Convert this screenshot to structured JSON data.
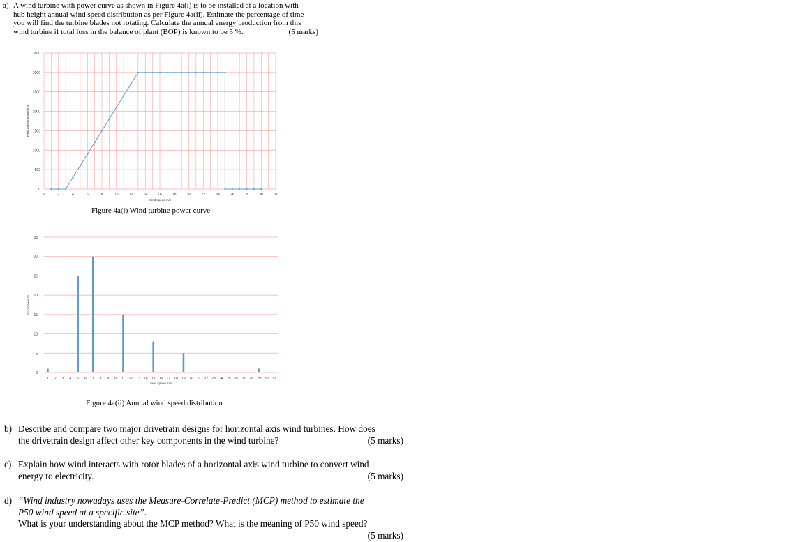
{
  "question_a": {
    "prefix": "a)",
    "lines": [
      "A wind turbine with power curve as shown in Figure 4a(i) is to be installed at a location with",
      "hub height annual wind speed distribution as per Figure 4a(ii). Estimate the percentage of time",
      "you will find the turbine blades not rotating. Calculate the annual energy production from this",
      "wind turbine if total loss in the balance of plant (BOP) is known to be 5 %."
    ],
    "marks": "(5 marks)"
  },
  "figure_a1": {
    "caption": "Figure 4a(i) Wind turbine power curve",
    "chart_data": {
      "type": "line",
      "xlabel": "Wind speed m/s",
      "ylabel": "Wind turbine power kW",
      "xlim": [
        0,
        32
      ],
      "ylim": [
        0,
        3500
      ],
      "x_ticks": [
        "0",
        "2",
        "4",
        "6",
        "8",
        "10",
        "12",
        "14",
        "16",
        "18",
        "20",
        "22",
        "24",
        "26",
        "28",
        "30",
        "32"
      ],
      "y_ticks": [
        "0",
        "500",
        "1000",
        "1500",
        "2000",
        "2500",
        "3000",
        "3500"
      ],
      "series": [
        {
          "color": "#5b9bd5",
          "points": [
            [
              1,
              0
            ],
            [
              2,
              0
            ],
            [
              3,
              0
            ],
            [
              4,
              300
            ],
            [
              5,
              600
            ],
            [
              6,
              900
            ],
            [
              7,
              1200
            ],
            [
              8,
              1500
            ],
            [
              9,
              1800
            ],
            [
              10,
              2100
            ],
            [
              11,
              2400
            ],
            [
              12,
              2700
            ],
            [
              13,
              3000
            ],
            [
              14,
              3000
            ],
            [
              15,
              3000
            ],
            [
              16,
              3000
            ],
            [
              17,
              3000
            ],
            [
              18,
              3000
            ],
            [
              19,
              3000
            ],
            [
              20,
              3000
            ],
            [
              21,
              3000
            ],
            [
              22,
              3000
            ],
            [
              23,
              3000
            ],
            [
              24,
              3000
            ],
            [
              25,
              3000
            ],
            [
              25,
              0
            ],
            [
              26,
              0
            ],
            [
              27,
              0
            ],
            [
              28,
              0
            ],
            [
              29,
              0
            ],
            [
              30,
              0
            ]
          ]
        }
      ],
      "grid": true,
      "grid_color": "#f4a6a6"
    }
  },
  "figure_a2": {
    "caption": "Figure 4a(ii) Annual wind speed distribution",
    "chart_data": {
      "type": "bar",
      "xlabel": "wind speed m/s",
      "ylabel": "Occurrence %",
      "ylim": [
        0,
        35
      ],
      "y_ticks": [
        "0",
        "5",
        "10",
        "15",
        "20",
        "25",
        "30",
        "35"
      ],
      "categories": [
        "1",
        "2",
        "3",
        "4",
        "5",
        "6",
        "7",
        "8",
        "9",
        "10",
        "11",
        "12",
        "13",
        "14",
        "15",
        "16",
        "17",
        "18",
        "19",
        "20",
        "21",
        "22",
        "23",
        "24",
        "25",
        "26",
        "27",
        "28",
        "29",
        "30",
        "31"
      ],
      "values": [
        1,
        0,
        0,
        0,
        25,
        0,
        30,
        0,
        0,
        0,
        15,
        0,
        0,
        0,
        8,
        0,
        0,
        0,
        5,
        0,
        0,
        0,
        0,
        0,
        0,
        0,
        0,
        0,
        1,
        0,
        0
      ],
      "color": "#5b9bd5",
      "grid": true,
      "grid_color": "#f4a6a6"
    }
  },
  "question_b": {
    "prefix": "b)",
    "lines": [
      "Describe and compare two major drivetrain designs for horizontal axis wind turbines. How does",
      "the drivetrain design affect other key components in the wind turbine?"
    ],
    "marks": "(5 marks)"
  },
  "question_c": {
    "prefix": "c)",
    "lines": [
      "Explain how wind interacts with rotor blades of a horizontal axis wind turbine to convert wind",
      "energy to electricity."
    ],
    "marks": "(5 marks)"
  },
  "question_d": {
    "prefix": "d)",
    "italic_lines": [
      "“Wind industry nowadays uses the Measure-Correlate-Predict (MCP) method to estimate the",
      "P50 wind speed at a specific site”."
    ],
    "line": "What is your understanding about the MCP method? What is the meaning of P50 wind speed?",
    "marks": "(5 marks)"
  }
}
